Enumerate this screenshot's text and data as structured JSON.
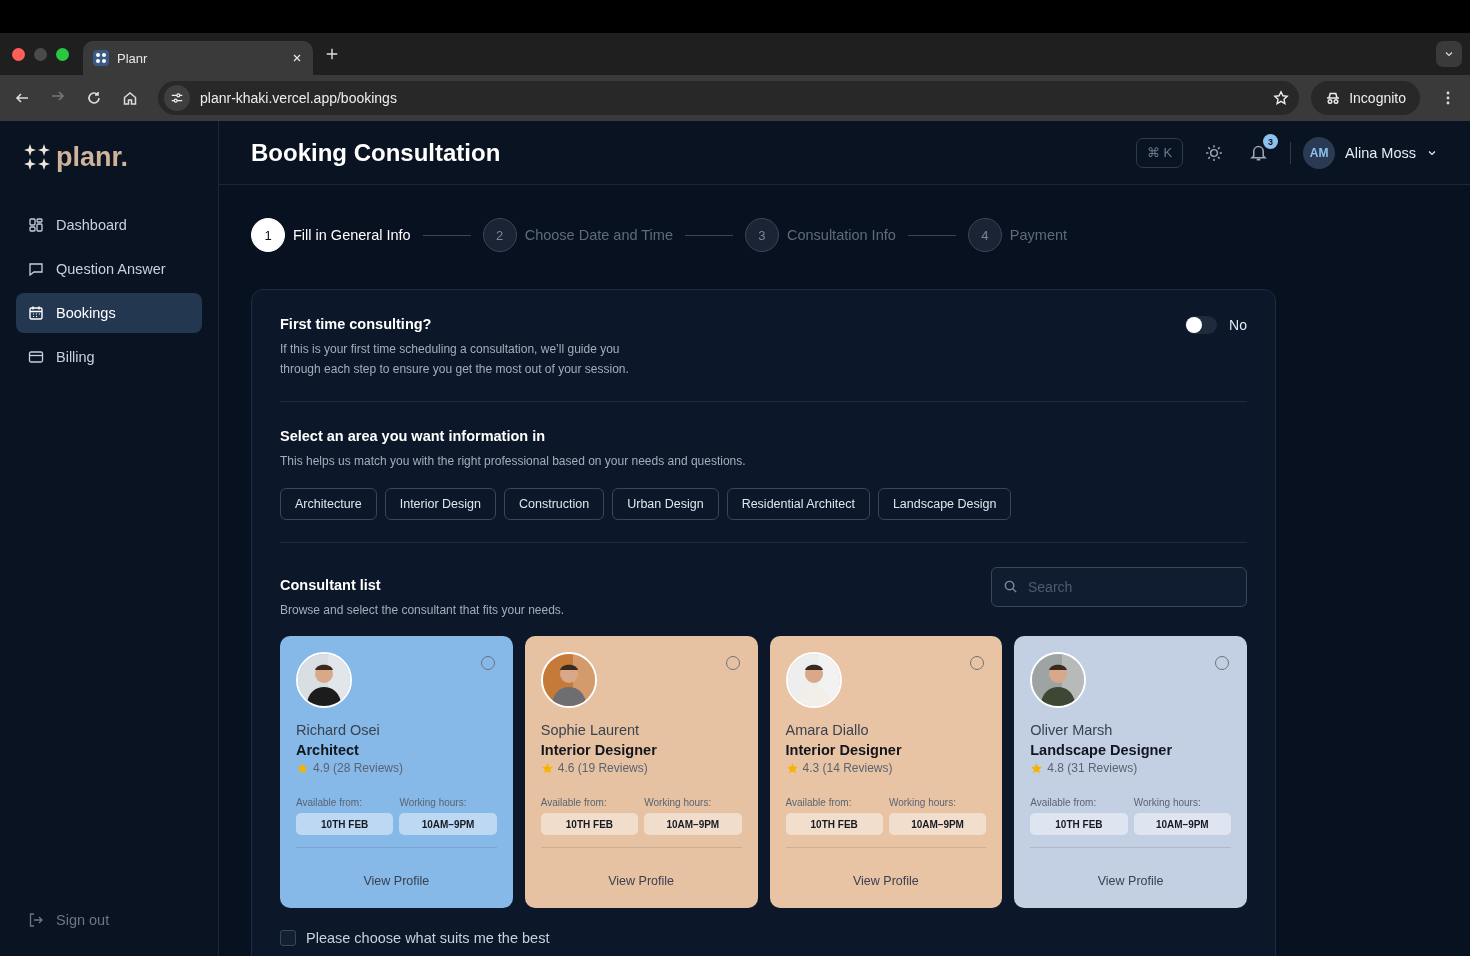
{
  "browser": {
    "tab_title": "Planr",
    "url": "planr-khaki.vercel.app/bookings",
    "profile": "Incognito"
  },
  "sidebar": {
    "logo": "planr.",
    "items": [
      {
        "label": "Dashboard",
        "selected": false
      },
      {
        "label": "Question Answer",
        "selected": false
      },
      {
        "label": "Bookings",
        "selected": true
      },
      {
        "label": "Billing",
        "selected": false
      }
    ],
    "sign_out": "Sign out"
  },
  "header": {
    "title": "Booking Consultation",
    "shortcut": "⌘ K",
    "notifications": "3",
    "user": {
      "initials": "AM",
      "name": "Alina Moss"
    }
  },
  "steps": [
    {
      "number": "1",
      "label": "Fill in General Info",
      "selected": true
    },
    {
      "number": "2",
      "label": "Choose Date and Time",
      "selected": false
    },
    {
      "number": "3",
      "label": "Consultation Info",
      "selected": false
    },
    {
      "number": "4",
      "label": "Payment",
      "selected": false
    }
  ],
  "first_time": {
    "title": "First time consulting?",
    "description": "If this is your first time scheduling a consultation, we’ll guide you through each step to ensure you get the most out of your session.",
    "toggle": {
      "on": false,
      "label": "No"
    }
  },
  "areas": {
    "title": "Select an area you want information in",
    "description": "This helps us match you with the right professional based on your needs and questions.",
    "chips": [
      "Architecture",
      "Interior Design",
      "Construction",
      "Urban Design",
      "Residential Architect",
      "Landscape Design"
    ]
  },
  "consultants": {
    "title": "Consultant list",
    "description": "Browse and select the consultant that fits your needs.",
    "search": {
      "placeholder": "Search"
    },
    "cards": [
      {
        "name": "Richard Osei",
        "role": "Architect",
        "rating": "4.9 (28 Reviews)",
        "available_label": "Available from:",
        "available": "10TH FEB",
        "hours_label": "Working hours:",
        "hours": "10AM–9PM",
        "link": "View Profile",
        "color": "#86b8e8",
        "selected": false
      },
      {
        "name": "Sophie Laurent",
        "role": "Interior Designer",
        "rating": "4.6 (19 Reviews)",
        "available_label": "Available from:",
        "available": "10TH FEB",
        "hours_label": "Working hours:",
        "hours": "10AM–9PM",
        "link": "View Profile",
        "color": "#e6c2a2",
        "selected": false
      },
      {
        "name": "Amara Diallo",
        "role": "Interior Designer",
        "rating": "4.3 (14 Reviews)",
        "available_label": "Available from:",
        "available": "10TH FEB",
        "hours_label": "Working hours:",
        "hours": "10AM–9PM",
        "link": "View Profile",
        "color": "#e8c4a4",
        "selected": false
      },
      {
        "name": "Oliver Marsh",
        "role": "Landscape Designer",
        "rating": "4.8 (31 Reviews)",
        "available_label": "Available from:",
        "available": "10TH FEB",
        "hours_label": "Working hours:",
        "hours": "10AM–9PM",
        "link": "View Profile",
        "color": "#c3cfe3",
        "selected": false
      }
    ]
  },
  "best_choice": {
    "label": "Please choose what suits me the best",
    "checked": false
  }
}
